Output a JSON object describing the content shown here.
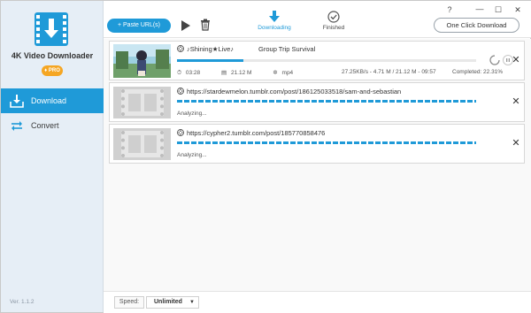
{
  "app": {
    "name": "4K Video Downloader",
    "pro_label": "PRO",
    "version": "Ver. 1.1.2"
  },
  "sidebar": {
    "items": [
      {
        "label": "Download",
        "icon": "download-tray-icon",
        "active": true
      },
      {
        "label": "Convert",
        "icon": "convert-arrows-icon",
        "active": false
      }
    ]
  },
  "toolbar": {
    "paste_label": "+ Paste URL(s)",
    "one_click_label": "One Click Download",
    "tabs": [
      {
        "label": "Downloading",
        "icon": "down-arrow-icon",
        "active": true
      },
      {
        "label": "Finished",
        "icon": "check-circle-icon",
        "active": false
      }
    ]
  },
  "window_controls": {
    "help": "?",
    "minimize": "—",
    "maximize": "☐",
    "close": "✕"
  },
  "downloads": [
    {
      "prefix": "♪Shining★Live♪",
      "title": "Group Trip Survival",
      "progress": 0.2231,
      "duration": "03:28",
      "size": "21.12 M",
      "format": "mp4",
      "transfer": "27.25KB/s - 4.71 M / 21.12 M - 09:57",
      "completed": "Completed: 22.31%"
    },
    {
      "url": "https://stardewmelon.tumblr.com/post/186125033518/sam-and-sebastian",
      "status": "Analyzing..."
    },
    {
      "url": "https://cypher2.tumblr.com/post/185770858476",
      "status": "Analyzing..."
    }
  ],
  "bottom": {
    "speed_label": "Speed:",
    "speed_value": "Unlimited"
  },
  "colors": {
    "accent": "#1f9ad8",
    "sidebar_bg": "#e6eef6",
    "pro_badge": "#f5a623"
  }
}
